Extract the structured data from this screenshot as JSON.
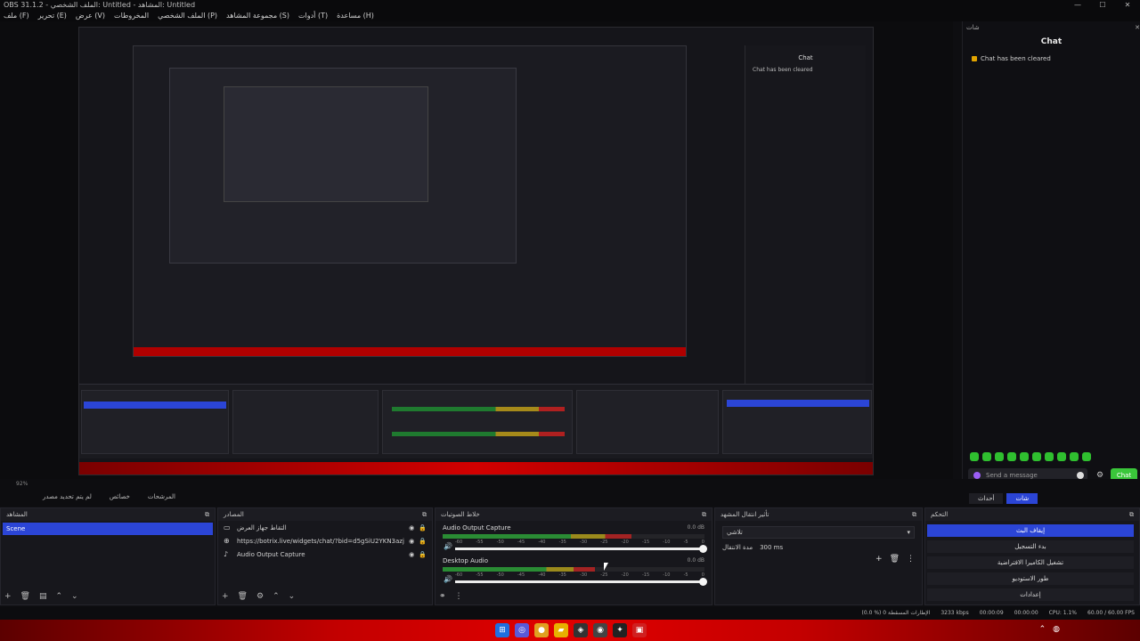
{
  "window": {
    "title": "OBS 31.1.2 - الملف الشخصي: Untitled - المشاهد: Untitled",
    "minimize": "—",
    "maximize": "☐",
    "close": "✕"
  },
  "menu": [
    "ملف (F)",
    "تحرير (E)",
    "عرض (V)",
    "المخروطات",
    "الملف الشخصي (P)",
    "مجموعة المشاهد (S)",
    "أدوات (T)",
    "مساعدة (H)"
  ],
  "chat_dock": {
    "header": "شات",
    "title": "Chat",
    "message": "Chat has been cleared",
    "input_placeholder": "Send a message",
    "send_label": "Chat",
    "gear": "⚙"
  },
  "preview": {
    "zoom": "92%",
    "studio_mode": "لم يتم تحديد مصدر",
    "properties": "خصائص",
    "filters": "المرشحات",
    "tab_chat": "شات",
    "tab_other": "أحداث"
  },
  "scenes": {
    "title": "المشاهد",
    "items": [
      "Scene"
    ]
  },
  "sources": {
    "title": "المصادر",
    "items": [
      {
        "icon": "monitor-icon",
        "label": "التقاط جهاز العرض"
      },
      {
        "icon": "globe-icon",
        "label": "https://botrix.live/widgets/chat/?bid=d5gSiU2YKN3azjWrLA%2FOG"
      },
      {
        "icon": "speaker-icon",
        "label": "Audio Output Capture"
      }
    ]
  },
  "mixer": {
    "title": "خلاط الصوتيات",
    "tracks": [
      {
        "name": "Audio Output Capture",
        "db": "0.0 dB",
        "level": 0.72
      },
      {
        "name": "Desktop Audio",
        "db": "0.0 dB",
        "level": 0.58
      }
    ],
    "ticks": [
      "-60",
      "-55",
      "-50",
      "-45",
      "-40",
      "-35",
      "-30",
      "-25",
      "-20",
      "-15",
      "-10",
      "-5",
      "0"
    ]
  },
  "transitions": {
    "title": "تأثير انتقال المشهد",
    "selected": "تلاشي",
    "duration_label": "مدة الانتقال",
    "duration_value": "300 ms"
  },
  "controls": {
    "title": "التحكم",
    "buttons": [
      "إيقاف البث",
      "بدء التسجيل",
      "تشغيل الكاميرا الافتراضية",
      "طور الاستوديو",
      "إعدادات"
    ]
  },
  "status": {
    "dropped": "(0.0 %) 0 الإطارات المسقطة",
    "bitrate": "3233 kbps",
    "time": "00:00:09",
    "rec": "00:00:00",
    "cpu": "CPU: 1.1%",
    "fps": "60.00 / 60.00 FPS"
  },
  "colors": {
    "accent": "#2b45d6",
    "chat_send": "#3ac63a",
    "taskbar": "#c40000"
  }
}
